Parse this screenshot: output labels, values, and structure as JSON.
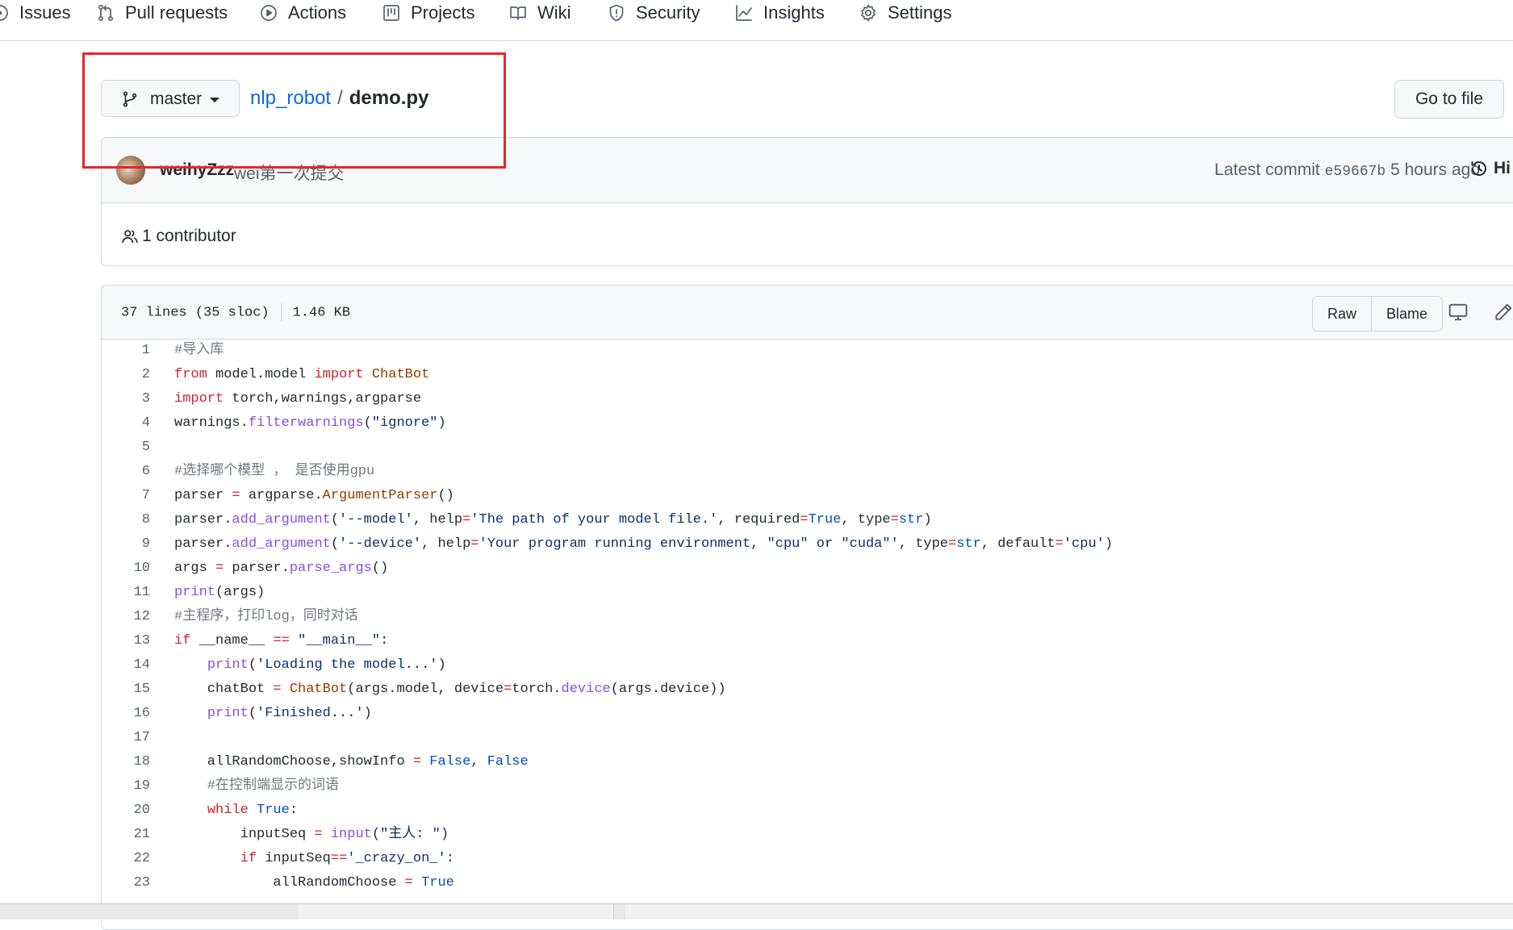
{
  "nav": {
    "tabs": [
      {
        "label": "Issues",
        "icon": "issue-icon"
      },
      {
        "label": "Pull requests",
        "icon": "pull-request-icon"
      },
      {
        "label": "Actions",
        "icon": "play-icon"
      },
      {
        "label": "Projects",
        "icon": "project-icon"
      },
      {
        "label": "Wiki",
        "icon": "book-icon"
      },
      {
        "label": "Security",
        "icon": "shield-icon"
      },
      {
        "label": "Insights",
        "icon": "graph-icon"
      },
      {
        "label": "Settings",
        "icon": "gear-icon"
      }
    ]
  },
  "branch": {
    "name": "master"
  },
  "breadcrumb": {
    "repo": "nlp_robot",
    "separator": "/",
    "file": "demo.py"
  },
  "go_to_file": "Go to file",
  "commit": {
    "author": "weihyZzz",
    "message": "wei第一次提交",
    "latest_label": "Latest commit",
    "sha": "e59667b",
    "time": "5 hours ago",
    "history_label": "Hi"
  },
  "contributors": "1 contributor",
  "file": {
    "lines_info": "37 lines (35 sloc)",
    "size": "1.46 KB",
    "raw_label": "Raw",
    "blame_label": "Blame"
  },
  "code_lines": [
    {
      "n": "1",
      "text": "#导入库"
    },
    {
      "n": "2",
      "text": "from model.model import ChatBot"
    },
    {
      "n": "3",
      "text": "import torch,warnings,argparse"
    },
    {
      "n": "4",
      "text": "warnings.filterwarnings(\"ignore\")"
    },
    {
      "n": "5",
      "text": ""
    },
    {
      "n": "6",
      "text": "#选择哪个模型 ， 是否使用gpu"
    },
    {
      "n": "7",
      "text": "parser = argparse.ArgumentParser()"
    },
    {
      "n": "8",
      "text": "parser.add_argument('--model', help='The path of your model file.', required=True, type=str)"
    },
    {
      "n": "9",
      "text": "parser.add_argument('--device', help='Your program running environment, \"cpu\" or \"cuda\"', type=str, default='cpu')"
    },
    {
      "n": "10",
      "text": "args = parser.parse_args()"
    },
    {
      "n": "11",
      "text": "print(args)"
    },
    {
      "n": "12",
      "text": "#主程序，打印log，同时对话"
    },
    {
      "n": "13",
      "text": "if __name__ == \"__main__\":"
    },
    {
      "n": "14",
      "text": "    print('Loading the model...')"
    },
    {
      "n": "15",
      "text": "    chatBot = ChatBot(args.model, device=torch.device(args.device))"
    },
    {
      "n": "16",
      "text": "    print('Finished...')"
    },
    {
      "n": "17",
      "text": ""
    },
    {
      "n": "18",
      "text": "    allRandomChoose,showInfo = False, False"
    },
    {
      "n": "19",
      "text": "    #在控制端显示的词语"
    },
    {
      "n": "20",
      "text": "    while True:"
    },
    {
      "n": "21",
      "text": "        inputSeq = input(\"主人: \")"
    },
    {
      "n": "22",
      "text": "        if inputSeq=='_crazy_on_':"
    },
    {
      "n": "23",
      "text": "            allRandomChoose = True"
    }
  ],
  "colors": {
    "link": "#0969da",
    "keyword": "#cf222e",
    "function": "#8250df",
    "string": "#0a3069",
    "comment": "#6e7781",
    "constant": "#0550ae",
    "highlight_box": "#e5262e"
  }
}
